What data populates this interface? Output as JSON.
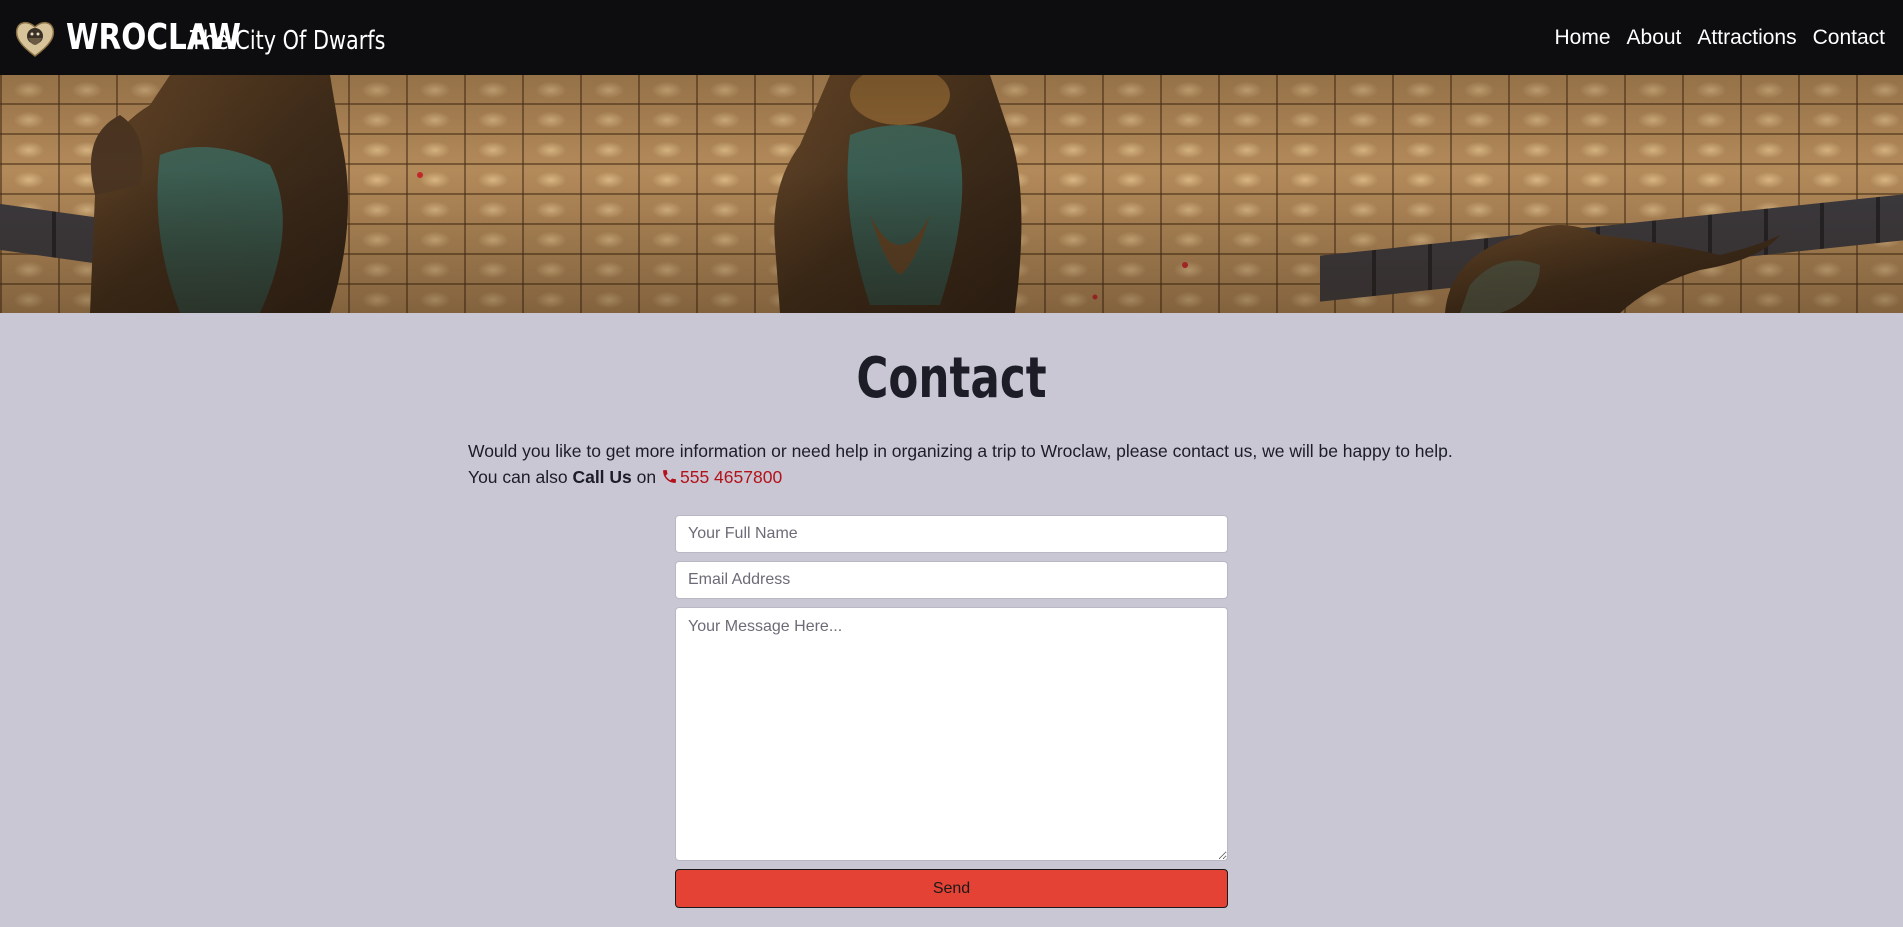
{
  "brand": {
    "title": "WROCLAW",
    "subtitle": "The City Of Dwarfs",
    "logo_icon": "dwarf-heart-logo"
  },
  "nav": {
    "items": [
      {
        "label": "Home"
      },
      {
        "label": "About"
      },
      {
        "label": "Attractions"
      },
      {
        "label": "Contact"
      }
    ]
  },
  "hero": {
    "image": "bronze-dwarf-statues-on-cobblestones"
  },
  "main": {
    "title": "Contact",
    "intro_line1": "Would you like to get more information or need help in organizing a trip to Wroclaw, please contact us, we will be happy to help.",
    "intro_prefix": "You can also",
    "intro_bold": "Call Us",
    "intro_on": "on",
    "phone_icon": "phone-icon",
    "phone_number": "555 4657800"
  },
  "form": {
    "name_placeholder": "Your Full Name",
    "email_placeholder": "Email Address",
    "message_placeholder": "Your Message Here...",
    "send_label": "Send"
  },
  "colors": {
    "navbar_bg": "#0d0d10",
    "page_bg": "#c8c7d3",
    "accent_red": "#e34235",
    "phone_red": "#b3121a"
  }
}
